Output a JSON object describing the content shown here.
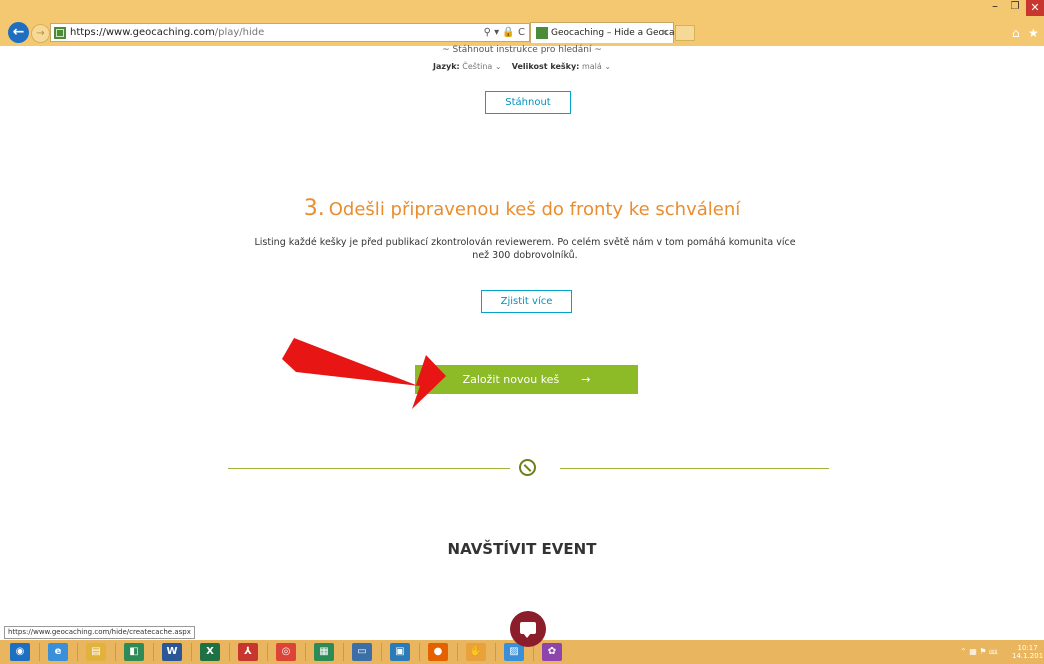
{
  "browser": {
    "url_host": "https://www.geocaching.com",
    "url_path": "/play/hide",
    "tab_title": "Geocaching – Hide a Geoca...",
    "tab_close": "×",
    "address_tools": "⚲ ▾ 🔒 C",
    "min": "–",
    "max": "❐",
    "close": "✕",
    "home": "⌂",
    "star": "★"
  },
  "download_section": {
    "instructions": "~ Stáhnout instrukce pro hledání ~",
    "language_label": "Jazyk:",
    "language_value": "Čeština",
    "size_label": "Velikost kešky:",
    "size_value": "malá",
    "download_button": "Stáhnout"
  },
  "step3": {
    "number": "3.",
    "title": "Odešli připravenou keš do fronty ke schválení",
    "description": "Listing každé kešky je před publikací zkontrolován reviewerem. Po celém světě nám v tom pomáhá komunita více než 300 dobrovolníků.",
    "more_button": "Zjistit více"
  },
  "create_button": {
    "label": "Založit novou keš",
    "arrow": "→"
  },
  "visit_event": {
    "title": "NAVŠTÍVIT EVENT"
  },
  "status_bar": {
    "hover_url": "https://www.geocaching.com/hide/createcache.aspx"
  },
  "taskbar": {
    "icons": [
      {
        "name": "start-icon",
        "color": "#1f6fc1",
        "glyph": "◉"
      },
      {
        "name": "ie-icon",
        "color": "#3a8fd9",
        "glyph": "e"
      },
      {
        "name": "explorer-icon",
        "color": "#e3b23c",
        "glyph": "▤"
      },
      {
        "name": "app-icon",
        "color": "#2e8b57",
        "glyph": "◧"
      },
      {
        "name": "word-icon",
        "color": "#2b5797",
        "glyph": "W"
      },
      {
        "name": "excel-icon",
        "color": "#1e7145",
        "glyph": "X"
      },
      {
        "name": "acrobat-icon",
        "color": "#c7372f",
        "glyph": "⅄"
      },
      {
        "name": "chrome-icon",
        "color": "#db4437",
        "glyph": "◎"
      },
      {
        "name": "calculator-icon",
        "color": "#2e8b57",
        "glyph": "▦"
      },
      {
        "name": "scanner-icon",
        "color": "#3c6fa8",
        "glyph": "▭"
      },
      {
        "name": "photos-icon",
        "color": "#2b7bb9",
        "glyph": "▣"
      },
      {
        "name": "firefox-icon",
        "color": "#e66000",
        "glyph": "●"
      },
      {
        "name": "paint-icon",
        "color": "#e9a23b",
        "glyph": "✋"
      },
      {
        "name": "gallery-icon",
        "color": "#3a8fd9",
        "glyph": "▨"
      },
      {
        "name": "picasa-icon",
        "color": "#8e44ad",
        "glyph": "✿"
      }
    ],
    "tray": "⌃ ▦ ⚑ ⅏",
    "clock_time": "10:17",
    "clock_date": "14.1.201"
  }
}
